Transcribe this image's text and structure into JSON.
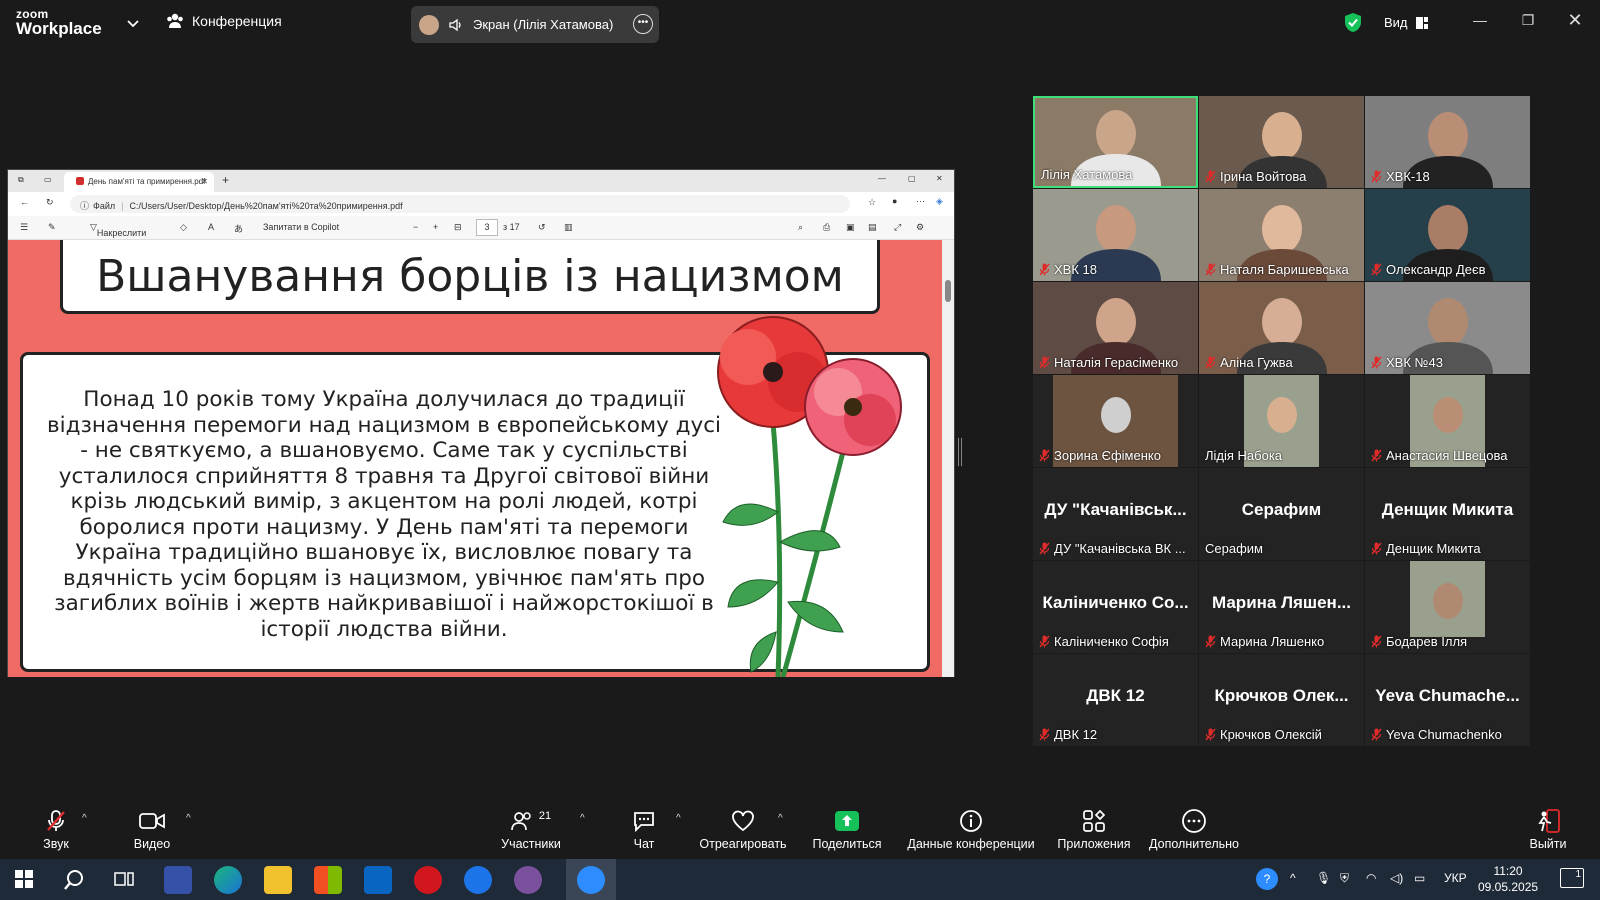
{
  "app": {
    "logo_top": "zoom",
    "logo_bottom": "Workplace",
    "meeting_label": "Конференция",
    "screen_share_label": "Экран (Лілія Хатамова)",
    "view_label": "Вид"
  },
  "browser": {
    "tab_title": "День пам'яті та примирення.pdf",
    "address_prefix": "Файл",
    "address": "C:/Users/User/Desktop/День%20пам'яті%20та%20примирення.pdf",
    "draw_label": "Накреслити",
    "copilot_label": "Запитати в Copilot",
    "page_current": "3",
    "page_total": "з 17"
  },
  "slide": {
    "title": "Вшанування борців із нацизмом",
    "lines": [
      "Понад 10 років тому Україна долучилася до традиції",
      "відзначення перемоги над нацизмом в європейському дусі",
      "- не святкуємо, а вшановуємо. Саме так у суспільстві",
      "усталилося сприйняття 8 травня та Другої світової війни",
      "крізь людський вимір, з акцентом на ролі людей, котрі",
      "боролися проти нацизму. У День пам'яті та перемоги",
      "Україна традиційно вшановує їх, висловлює повагу та",
      "вдячність усім борцям із нацизмом, увічнює пам'ять про",
      "загиблих воїнів і жертв найкривавішої і найжорстокішої в",
      "історії людства війни."
    ]
  },
  "participants": [
    {
      "name": "Лілія Хатамова",
      "video": true,
      "muted": false,
      "active": true,
      "big": ""
    },
    {
      "name": "Ірина Войтова",
      "video": true,
      "muted": true,
      "active": false,
      "big": ""
    },
    {
      "name": "ХВК-18",
      "video": true,
      "muted": true,
      "active": false,
      "big": ""
    },
    {
      "name": "ХВК 18",
      "video": true,
      "muted": true,
      "active": false,
      "big": ""
    },
    {
      "name": "Наталя Баришевська",
      "video": true,
      "muted": true,
      "active": false,
      "big": ""
    },
    {
      "name": "Олександр Деєв",
      "video": true,
      "muted": true,
      "active": false,
      "big": ""
    },
    {
      "name": "Наталія Герасіменко",
      "video": true,
      "muted": true,
      "active": false,
      "big": ""
    },
    {
      "name": "Аліна Гужва",
      "video": true,
      "muted": true,
      "active": false,
      "big": ""
    },
    {
      "name": "ХВК №43",
      "video": true,
      "muted": true,
      "active": false,
      "big": ""
    },
    {
      "name": "Зорина Єфіменко",
      "video": false,
      "photo": true,
      "muted": true,
      "active": false,
      "big": ""
    },
    {
      "name": "Лідія Набока",
      "video": false,
      "photo": true,
      "muted": false,
      "active": false,
      "big": ""
    },
    {
      "name": "Анастасия Швецова",
      "video": false,
      "photo": true,
      "muted": true,
      "active": false,
      "big": ""
    },
    {
      "name": "ДУ \"Качанівська ВК ...",
      "video": false,
      "muted": true,
      "active": false,
      "big": "ДУ \"Качанівськ..."
    },
    {
      "name": "Серафим",
      "video": false,
      "muted": false,
      "active": false,
      "big": "Серафим"
    },
    {
      "name": "Денщик Микита",
      "video": false,
      "muted": true,
      "active": false,
      "big": "Денщик Микита"
    },
    {
      "name": "Каліниченко Софія",
      "video": false,
      "muted": true,
      "active": false,
      "big": "Каліниченко Со..."
    },
    {
      "name": "Марина Ляшенко",
      "video": false,
      "muted": true,
      "active": false,
      "big": "Марина Ляшен..."
    },
    {
      "name": "Бодарев Ілля",
      "video": false,
      "photo": true,
      "muted": true,
      "active": false,
      "big": ""
    },
    {
      "name": "ДВК 12",
      "video": false,
      "muted": true,
      "active": false,
      "big": "ДВК 12"
    },
    {
      "name": "Крючков Олексій",
      "video": false,
      "muted": true,
      "active": false,
      "big": "Крючков Олек..."
    },
    {
      "name": "Yeva Chumachenko",
      "video": false,
      "muted": true,
      "active": false,
      "big": "Yeva Chumache..."
    }
  ],
  "toolbar": {
    "audio": "Звук",
    "video": "Видео",
    "participants": "Участники",
    "participants_count": "21",
    "chat": "Чат",
    "react": "Отреагировать",
    "share": "Поделиться",
    "info": "Данные конференции",
    "apps": "Приложения",
    "more": "Дополнительно",
    "leave": "Выйти"
  },
  "taskbar": {
    "lang": "УКР",
    "time": "11:20",
    "date": "09.05.2025",
    "notifications": "1"
  },
  "colors": {
    "active_border": "#3ee07a",
    "muted_red": "#e02b2b",
    "share_green": "#17c15a",
    "slide_bg": "#f06b66"
  }
}
